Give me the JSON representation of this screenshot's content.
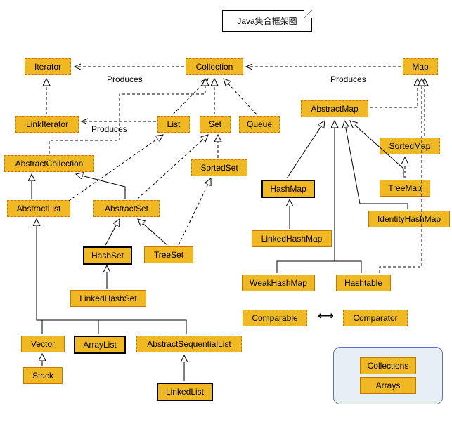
{
  "title": "Java集合框架图",
  "edge_labels": {
    "produces1": "Produces",
    "produces2": "Produces",
    "produces3": "Produces"
  },
  "nodes": {
    "iterator": "Iterator",
    "collection": "Collection",
    "map": "Map",
    "linkIterator": "LinkIterator",
    "list": "List",
    "set": "Set",
    "queue": "Queue",
    "abstractCollection": "AbstractCollection",
    "abstractList": "AbstractList",
    "abstractSet": "AbstractSet",
    "sortedSet": "SortedSet",
    "hashSet": "HashSet",
    "treeSet": "TreeSet",
    "linkedHashSet": "LinkedHashSet",
    "vector": "Vector",
    "arrayList": "ArrayList",
    "abstractSequentialList": "AbstractSequentialList",
    "stack": "Stack",
    "linkedList": "LinkedList",
    "abstractMap": "AbstractMap",
    "sortedMap": "SortedMap",
    "hashMap": "HashMap",
    "treeMap": "TreeMap",
    "identityHashMap": "IdentityHashMap",
    "linkedHashMap": "LinkedHashMap",
    "weakHashMap": "WeakHashMap",
    "hashtable": "Hashtable",
    "comparable": "Comparable",
    "comparator": "Comparator",
    "collections": "Collections",
    "arrays": "Arrays"
  },
  "chart_data": {
    "type": "diagram",
    "title": "Java集合框架图",
    "interfaces": [
      "Iterator",
      "LinkIterator",
      "Collection",
      "List",
      "Set",
      "Queue",
      "SortedSet",
      "Map",
      "SortedMap",
      "Comparable",
      "Comparator"
    ],
    "abstract_classes": [
      "AbstractCollection",
      "AbstractList",
      "AbstractSet",
      "AbstractMap",
      "AbstractSequentialList"
    ],
    "concrete_classes": [
      "HashSet",
      "TreeSet",
      "LinkedHashSet",
      "Vector",
      "ArrayList",
      "Stack",
      "LinkedList",
      "HashMap",
      "TreeMap",
      "IdentityHashMap",
      "LinkedHashMap",
      "WeakHashMap",
      "Hashtable",
      "Collections",
      "Arrays"
    ],
    "emphasized_classes": [
      "HashSet",
      "ArrayList",
      "LinkedList",
      "HashMap"
    ],
    "extends_implements": [
      [
        "LinkIterator",
        "Iterator"
      ],
      [
        "List",
        "Collection"
      ],
      [
        "Set",
        "Collection"
      ],
      [
        "Queue",
        "Collection"
      ],
      [
        "AbstractCollection",
        "Collection"
      ],
      [
        "AbstractList",
        "AbstractCollection"
      ],
      [
        "AbstractSet",
        "AbstractCollection"
      ],
      [
        "AbstractList",
        "List"
      ],
      [
        "AbstractSet",
        "Set"
      ],
      [
        "SortedSet",
        "Set"
      ],
      [
        "HashSet",
        "AbstractSet"
      ],
      [
        "TreeSet",
        "AbstractSet"
      ],
      [
        "TreeSet",
        "SortedSet"
      ],
      [
        "LinkedHashSet",
        "HashSet"
      ],
      [
        "Vector",
        "AbstractList"
      ],
      [
        "ArrayList",
        "AbstractList"
      ],
      [
        "AbstractSequentialList",
        "AbstractList"
      ],
      [
        "Stack",
        "Vector"
      ],
      [
        "LinkedList",
        "AbstractSequentialList"
      ],
      [
        "AbstractMap",
        "Map"
      ],
      [
        "SortedMap",
        "Map"
      ],
      [
        "HashMap",
        "AbstractMap"
      ],
      [
        "TreeMap",
        "AbstractMap"
      ],
      [
        "TreeMap",
        "SortedMap"
      ],
      [
        "IdentityHashMap",
        "AbstractMap"
      ],
      [
        "WeakHashMap",
        "AbstractMap"
      ],
      [
        "Hashtable",
        "AbstractMap"
      ],
      [
        "Hashtable",
        "Map"
      ],
      [
        "LinkedHashMap",
        "HashMap"
      ]
    ],
    "produces": [
      [
        "Collection",
        "Iterator"
      ],
      [
        "List",
        "LinkIterator"
      ],
      [
        "Map",
        "Collection"
      ]
    ],
    "associations": [
      [
        "Comparable",
        "Comparator"
      ]
    ]
  }
}
